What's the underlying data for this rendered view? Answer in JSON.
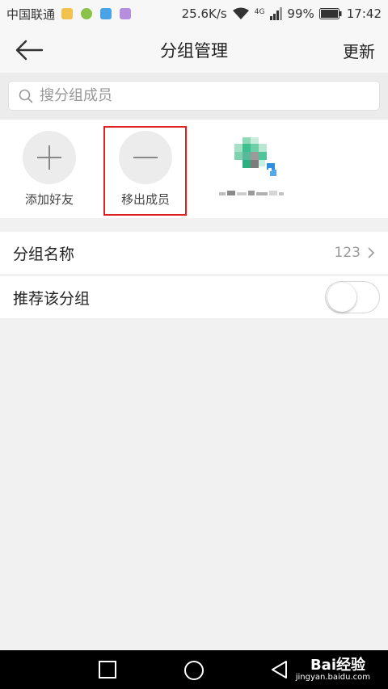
{
  "status_bar": {
    "carrier": "中国联通",
    "net_speed": "25.6K/s",
    "network_type": "4G",
    "battery": "99%",
    "time": "17:42"
  },
  "header": {
    "title": "分组管理",
    "action": "更新"
  },
  "search": {
    "placeholder": "搜分组成员"
  },
  "members": {
    "add_label": "添加好友",
    "remove_label": "移出成员"
  },
  "settings": {
    "group_name_label": "分组名称",
    "group_name_value": "123",
    "recommend_label": "推荐该分组",
    "recommend_enabled": false
  },
  "watermark": {
    "brand": "Bai经验",
    "url": "jingyan.baidu.com"
  },
  "colors": {
    "highlight": "#e02020",
    "background": "#f1f1f1"
  }
}
